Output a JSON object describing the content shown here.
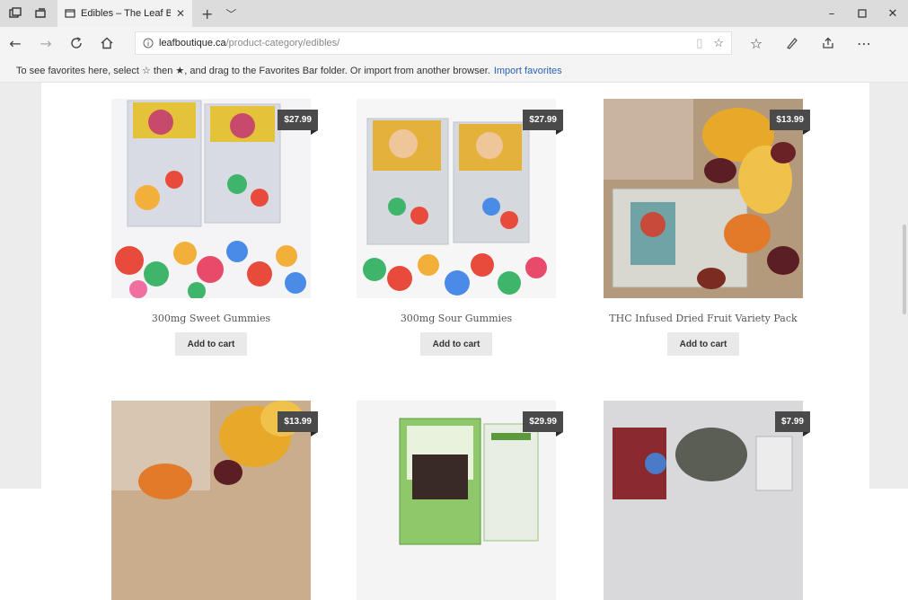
{
  "browser": {
    "tab_title": "Edibles – The Leaf Bouti",
    "url_host": "leafboutique.ca",
    "url_path": "/product-category/edibles/"
  },
  "favorites_bar": {
    "message": "To see favorites here, select ☆ then ★, and drag to the Favorites Bar folder. Or import from another browser.",
    "import_link": "Import favorites"
  },
  "products": [
    {
      "name": "300mg Sweet Gummies",
      "price": "$27.99",
      "button": "Add to cart"
    },
    {
      "name": "300mg Sour Gummies",
      "price": "$27.99",
      "button": "Add to cart"
    },
    {
      "name": "THC Infused Dried Fruit Variety Pack",
      "price": "$13.99",
      "button": "Add to cart"
    },
    {
      "name": "",
      "price": "$13.99",
      "button": ""
    },
    {
      "name": "",
      "price": "$29.99",
      "button": ""
    },
    {
      "name": "",
      "price": "$7.99",
      "button": ""
    }
  ],
  "icons": {
    "tab_actions": "tab-actions-icon",
    "back": "back-arrow-icon",
    "forward": "forward-arrow-icon",
    "refresh": "refresh-icon",
    "home": "home-icon",
    "reading_view": "reading-view-icon",
    "favorite": "star-icon",
    "hub": "favorites-hub-icon",
    "notes": "pen-icon",
    "share": "share-icon",
    "more": "more-icon"
  }
}
